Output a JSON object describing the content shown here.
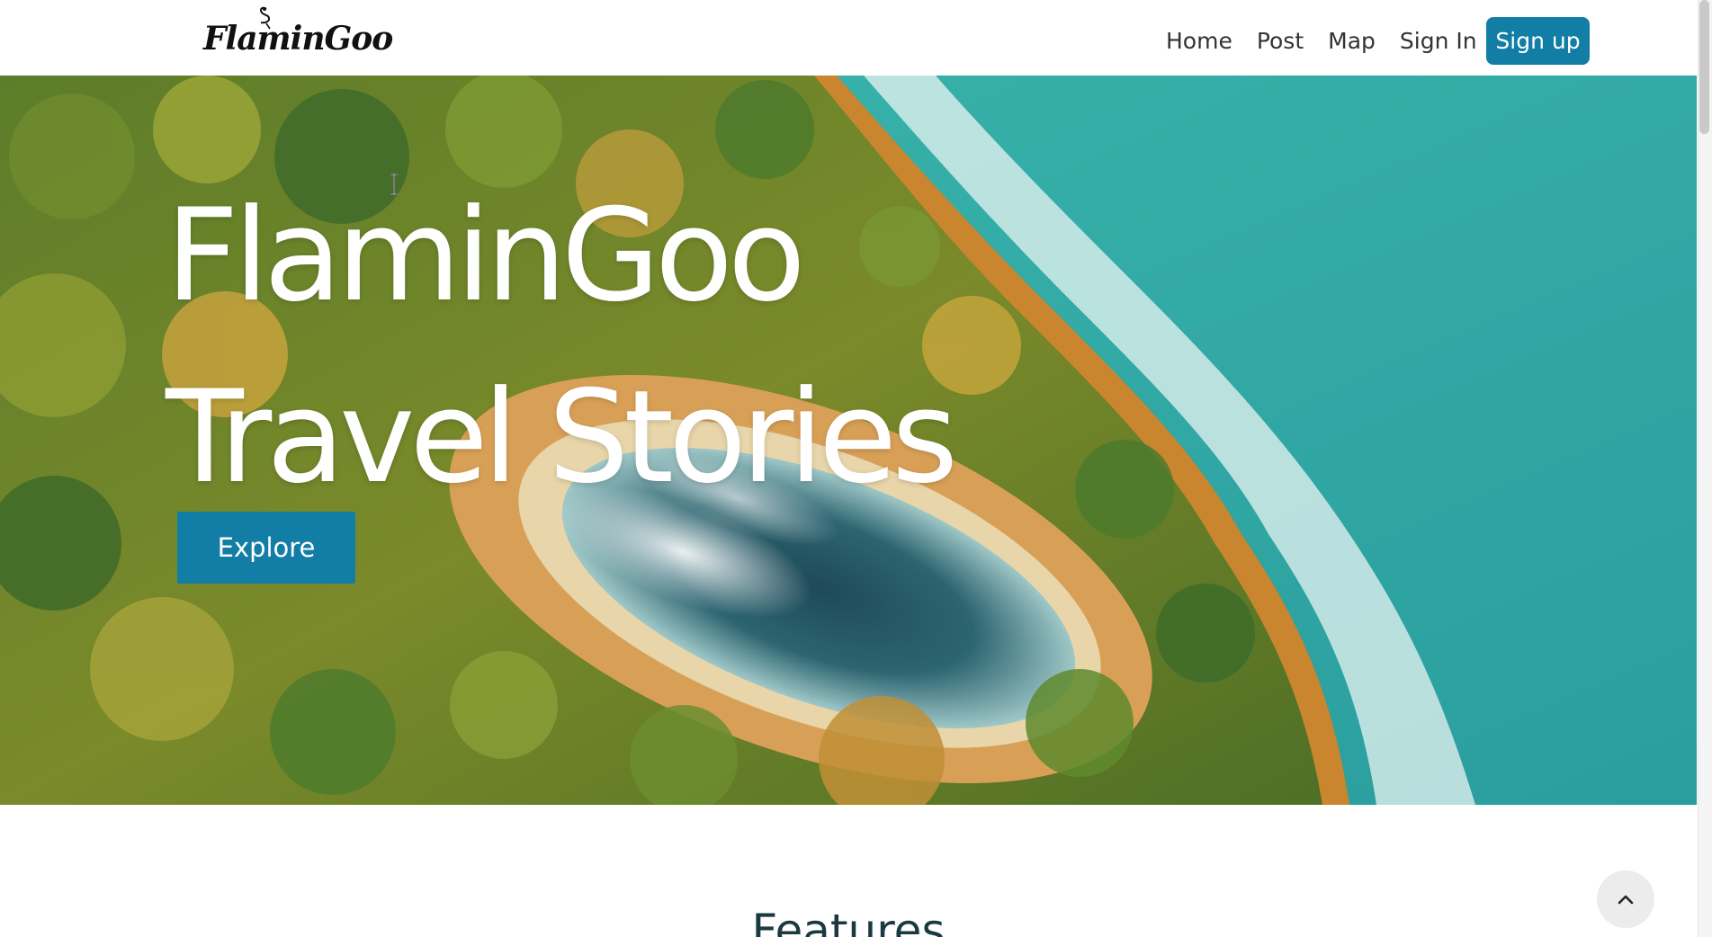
{
  "nav": {
    "logo_text": "FlaminGoo",
    "links": [
      "Home",
      "Post",
      "Map",
      "Sign In"
    ],
    "signup_label": "Sign up"
  },
  "hero": {
    "title_line1": "FlaminGoo",
    "title_line2": "Travel Stories",
    "explore_label": "Explore"
  },
  "features": {
    "title": "Features"
  },
  "colors": {
    "primary": "#127ea6",
    "heading": "#1b3942",
    "sea": "#2fa9a4"
  },
  "icons": {
    "scroll_top": "chevron-up-icon",
    "cursor": "text-cursor-icon"
  }
}
